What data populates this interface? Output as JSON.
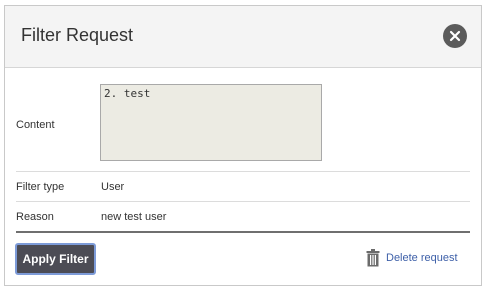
{
  "dialog": {
    "title": "Filter Request",
    "close_icon": "close-circle-icon"
  },
  "fields": {
    "content_label": "Content",
    "content_value": "2. test",
    "filter_type_label": "Filter type",
    "filter_type_value": "User",
    "reason_label": "Reason",
    "reason_value": "new test user"
  },
  "footer": {
    "apply_label": "Apply Filter",
    "delete_label": "Delete request",
    "delete_icon": "trash-icon"
  },
  "colors": {
    "header_bg": "#f4f4f4",
    "apply_bg": "#4c4c55",
    "apply_border": "#7d9bd8",
    "link": "#3d5fa8",
    "content_bg": "#ecebe3"
  }
}
